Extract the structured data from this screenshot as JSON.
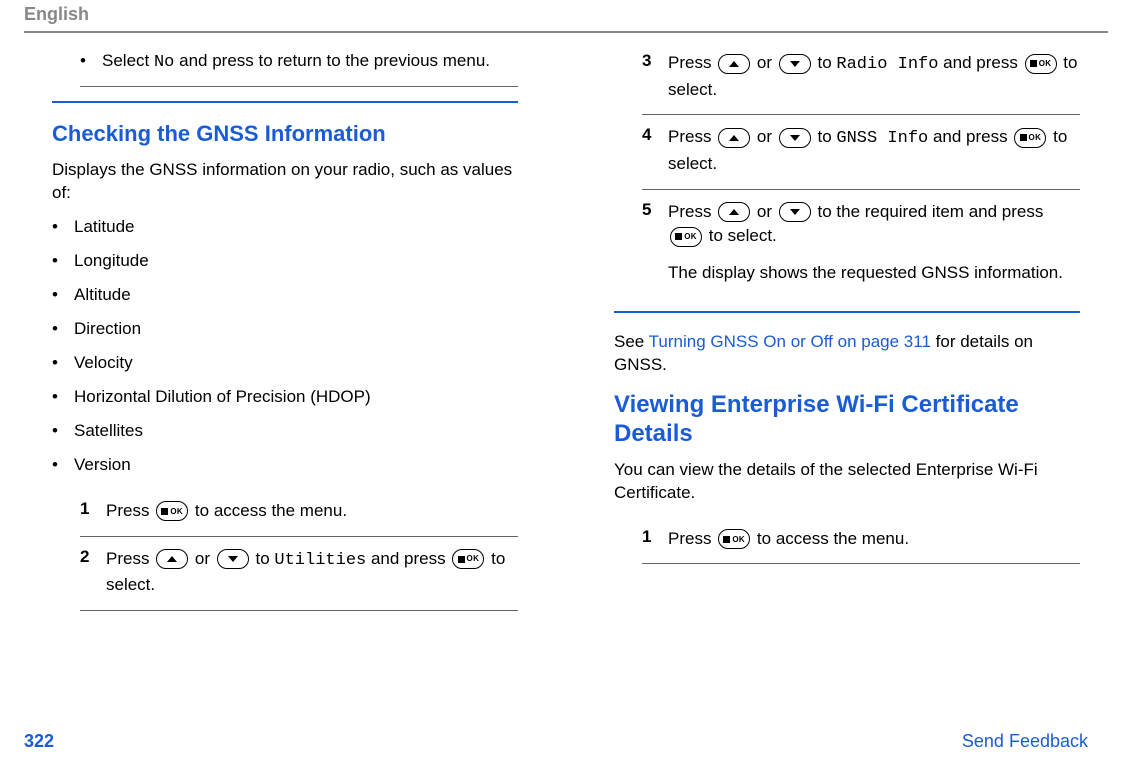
{
  "header": {
    "language": "English"
  },
  "leftcol": {
    "topbullet": {
      "pre": "Select ",
      "mono": "No",
      "post": " and press to return to the previous menu."
    },
    "heading1": "Checking the GNSS Information",
    "intro": "Displays the GNSS information on your radio, such as values of:",
    "items": [
      "Latitude",
      "Longitude",
      "Altitude",
      "Direction",
      "Velocity",
      "Horizontal Dilution of Precision (HDOP)",
      "Satellites",
      "Version"
    ],
    "step1": {
      "num": "1",
      "pre": "Press ",
      "post": " to access the menu."
    },
    "step2": {
      "num": "2",
      "pre": "Press ",
      "mid1": " or ",
      "mid2": " to ",
      "mono": "Utilities",
      "mid3": " and press ",
      "post": " to select."
    }
  },
  "rightcol": {
    "step3": {
      "num": "3",
      "pre": "Press ",
      "mid1": " or ",
      "mid2": " to ",
      "mono": "Radio Info",
      "mid3": " and press ",
      "post": " to select."
    },
    "step4": {
      "num": "4",
      "pre": "Press ",
      "mid1": " or ",
      "mid2": " to ",
      "mono": "GNSS Info",
      "mid3": " and press ",
      "post": " to select."
    },
    "step5": {
      "num": "5",
      "pre": "Press ",
      "mid1": " or ",
      "mid2": " to the required item and press ",
      "post": " to select.",
      "line2": "The display shows the requested GNSS information."
    },
    "see_pre": "See ",
    "see_link": "Turning GNSS On or Off on page 311",
    "see_post": " for details on GNSS.",
    "heading2": "Viewing Enterprise Wi-Fi Certificate Details",
    "intro2": "You can view the details of the selected Enterprise Wi-Fi Certificate.",
    "step_r1": {
      "num": "1",
      "pre": "Press ",
      "post": " to access the menu."
    }
  },
  "footer": {
    "page": "322",
    "feedback": "Send Feedback"
  },
  "icons": {
    "ok": "OK"
  }
}
